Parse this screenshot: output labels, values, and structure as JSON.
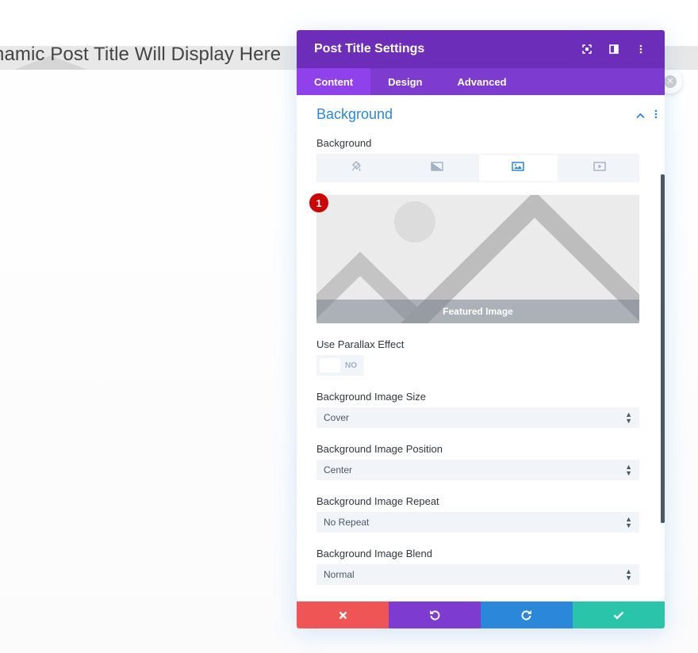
{
  "page": {
    "post_title": "namic Post Title Will Display Here"
  },
  "modal": {
    "title": "Post Title Settings",
    "tabs": [
      {
        "label": "Content",
        "active": true
      },
      {
        "label": "Design",
        "active": false
      },
      {
        "label": "Advanced",
        "active": false
      }
    ],
    "section": {
      "title": "Background"
    },
    "background_label": "Background",
    "background_tabs": [
      "paint-bucket-icon",
      "gradient-icon",
      "image-icon",
      "video-icon"
    ],
    "preview": {
      "badge": "1",
      "label": "Featured Image"
    },
    "parallax": {
      "label": "Use Parallax Effect",
      "value": "NO"
    },
    "fields": [
      {
        "label": "Background Image Size",
        "value": "Cover"
      },
      {
        "label": "Background Image Position",
        "value": "Center"
      },
      {
        "label": "Background Image Repeat",
        "value": "No Repeat"
      },
      {
        "label": "Background Image Blend",
        "value": "Normal"
      }
    ]
  },
  "colors": {
    "header": "#6c2eb9",
    "tabs": "#7e3bd0",
    "accent": "#2b87da",
    "cancel": "#ef5555",
    "undo": "#7e3bd0",
    "redo": "#2b87da",
    "save": "#29c4a9"
  }
}
